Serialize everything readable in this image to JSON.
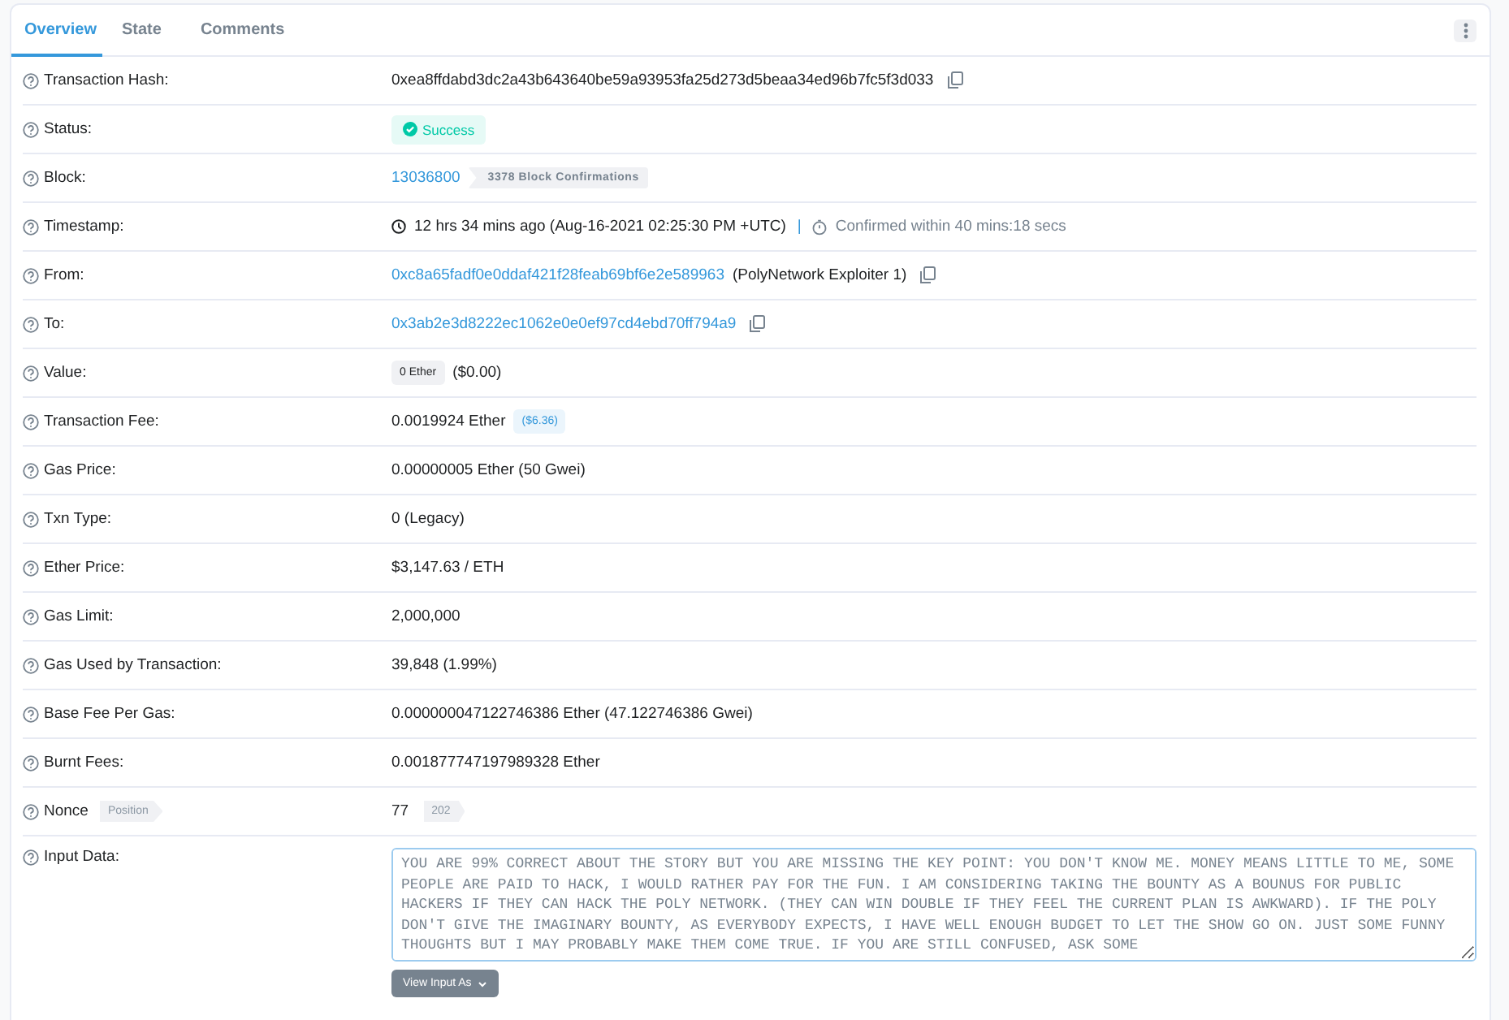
{
  "tabs": [
    {
      "label": "Overview",
      "selected": true
    },
    {
      "label": "State",
      "selected": false
    },
    {
      "label": "Comments",
      "selected": false
    }
  ],
  "rows": [
    {
      "label": "Transaction Hash:",
      "kind": "hash",
      "value": "0xea8ffdabd3dc2a43b643640be59a93953fa25d273d5beaa34ed96b7fc5f3d033"
    },
    {
      "label": "Status:",
      "kind": "status",
      "value": "Success"
    },
    {
      "label": "Block:",
      "kind": "block",
      "value": "13036800",
      "tag": "3378 Block Confirmations"
    },
    {
      "label": "Timestamp:",
      "kind": "timestamp",
      "value": "12 hrs 34 mins ago (Aug-16-2021 02:25:30 PM +UTC)",
      "separator": "|",
      "note": "Confirmed within 40 mins:18 secs"
    },
    {
      "label": "From:",
      "kind": "address",
      "value": "0xc8a65fadf0e0ddaf421f28feab69bf6e2e589963",
      "name": "(PolyNetwork Exploiter 1)"
    },
    {
      "label": "To:",
      "kind": "address",
      "value": "0x3ab2e3d8222ec1062e0e0ef97cd4ebd70ff794a9"
    },
    {
      "label": "Value:",
      "kind": "amount",
      "tag": "0 Ether",
      "value": "($0.00)"
    },
    {
      "label": "Transaction Fee:",
      "kind": "fee",
      "value": "0.0019924 Ether",
      "tag": "($6.36)"
    },
    {
      "label": "Gas Price:",
      "kind": "text",
      "value": "0.00000005 Ether (50 Gwei)"
    },
    {
      "label": "Txn Type:",
      "kind": "text",
      "value": "0 (Legacy)"
    },
    {
      "label": "Ether Price:",
      "kind": "text",
      "value": "$3,147.63 / ETH"
    },
    {
      "label": "Gas Limit:",
      "kind": "text",
      "value": "2,000,000"
    },
    {
      "label": "Gas Used by Transaction:",
      "kind": "text",
      "value": "39,848 (1.99%)"
    },
    {
      "label": "Base Fee Per Gas:",
      "kind": "text",
      "value": "0.000000047122746386 Ether (47.122746386 Gwei)"
    },
    {
      "label": "Burnt Fees:",
      "kind": "text",
      "value": "0.001877747197989328 Ether"
    },
    {
      "label": "Nonce",
      "label_tag": "Position",
      "kind": "nonce",
      "value": "77",
      "tag": "202"
    },
    {
      "label": "Input Data:",
      "kind": "input",
      "value": "YOU ARE 99% CORRECT ABOUT THE STORY BUT YOU ARE MISSING THE KEY POINT: YOU DON'T KNOW ME. MONEY MEANS LITTLE TO ME, SOME PEOPLE ARE PAID TO HACK, I WOULD RATHER PAY FOR THE FUN. I AM CONSIDERING TAKING THE BOUNTY AS A BOUNUS FOR PUBLIC HACKERS IF THEY CAN HACK THE POLY NETWORK. (THEY CAN WIN DOUBLE IF THEY FEEL THE CURRENT PLAN IS AWKWARD). IF THE POLY DON'T GIVE THE IMAGINARY BOUNTY, AS EVERYBODY EXPECTS, I HAVE WELL ENOUGH BUDGET TO LET THE SHOW GO ON. JUST SOME FUNNY THOUGHTS BUT I MAY PROBABLY MAKE THEM COME TRUE. IF YOU ARE STILL CONFUSED, ASK SOME",
      "button": "View Input As"
    }
  ]
}
